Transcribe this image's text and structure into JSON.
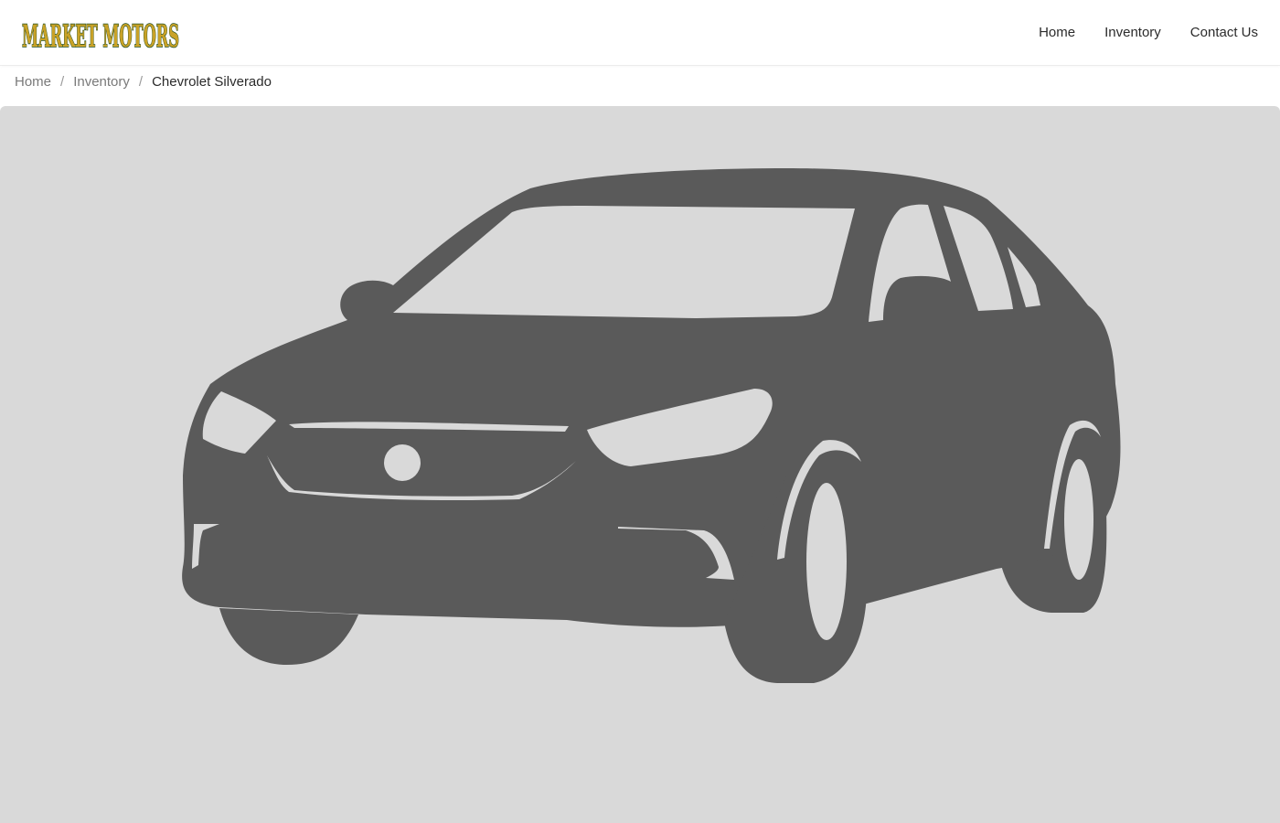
{
  "header": {
    "logo_text": "MARKET MOTORS",
    "nav": [
      {
        "label": "Home"
      },
      {
        "label": "Inventory"
      },
      {
        "label": "Contact Us"
      }
    ]
  },
  "breadcrumb": {
    "items": [
      {
        "label": "Home"
      },
      {
        "label": "Inventory"
      }
    ],
    "separator": "/",
    "current": "Chevrolet Silverado"
  },
  "hero": {
    "image": "car-placeholder-icon"
  },
  "colors": {
    "logo_fill": "#c9a227",
    "logo_outline": "#1f4d24",
    "hero_bg": "#d9d9d9",
    "car_silhouette": "#5a5a5a"
  }
}
